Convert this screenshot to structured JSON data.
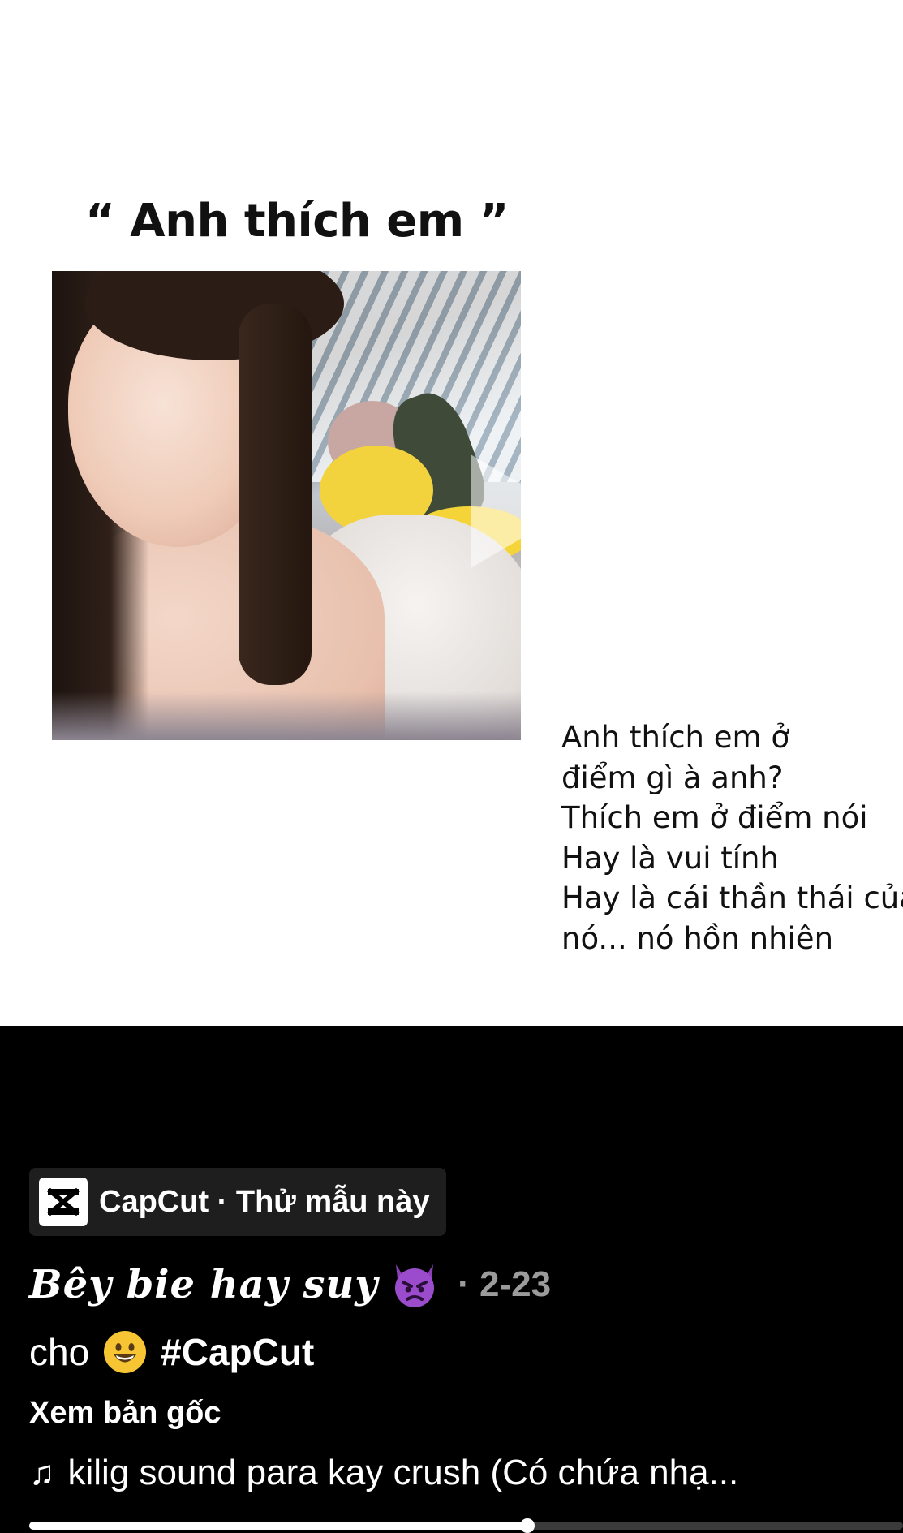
{
  "video": {
    "quote_title": "“ Anh thích em ”",
    "lyrics": [
      "Anh thích em ở",
      "điểm gì à anh?",
      "Thích em ở điểm nói",
      "Hay là vui tính",
      "Hay là cái thần thái của",
      "nó... nó hồn nhiên"
    ]
  },
  "capcut": {
    "label": "CapCut · Thử mẫu này",
    "icon": "capcut-logo-icon"
  },
  "post": {
    "title": "𝑩ê𝒚 𝒃𝒊𝒆 𝒉𝒂𝒚 𝒔𝒖𝒚",
    "title_emoji": "devil-emoji",
    "date": "· 2-23",
    "desc_prefix": "cho",
    "desc_emoji": "smile-emoji",
    "hashtag": "#CapCut",
    "see_original": "Xem bản gốc",
    "music_icon": "music-note-icon",
    "music_note": "♫",
    "music": "kilig sound para kay crush (Có chứa nhạ..."
  },
  "playback": {
    "progress": 0.57
  }
}
